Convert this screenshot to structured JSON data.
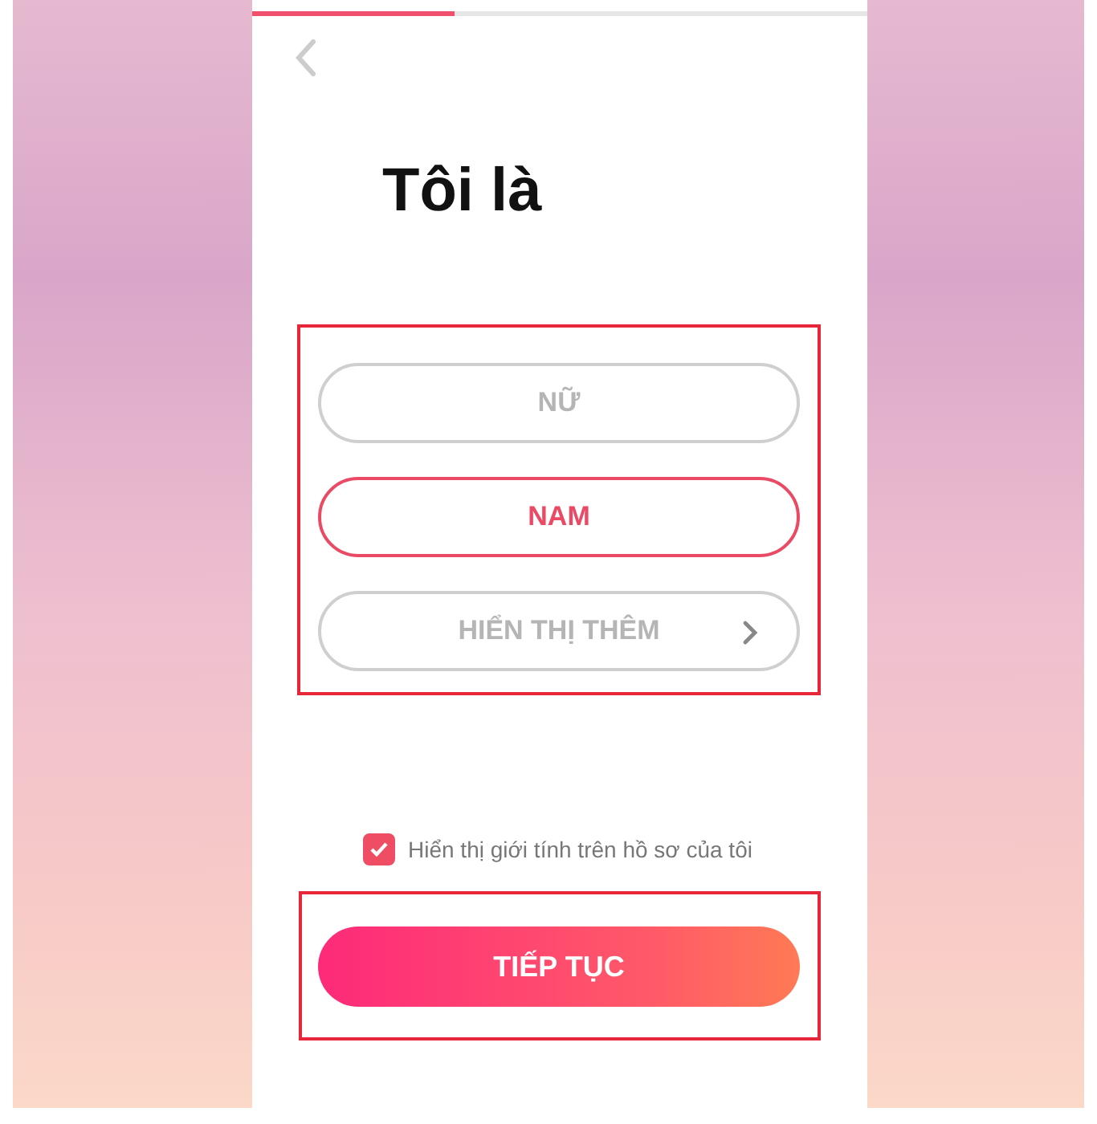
{
  "progress": {
    "level": 0.33
  },
  "title": "Tôi là",
  "options": [
    {
      "label": "NỮ",
      "kind": "option",
      "selected": false
    },
    {
      "label": "NAM",
      "kind": "option",
      "selected": true
    },
    {
      "label": "HIỂN THỊ THÊM",
      "kind": "more",
      "selected": false
    }
  ],
  "show_gender": {
    "label": "Hiển thị giới tính trên hồ sơ của tôi",
    "checked": true
  },
  "continue_button": "TIẾP TỤC"
}
